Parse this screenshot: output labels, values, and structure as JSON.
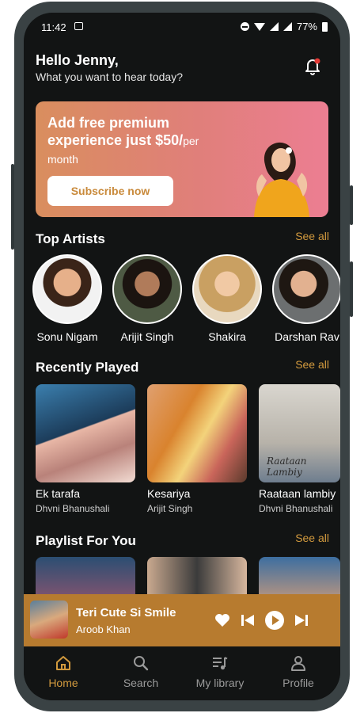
{
  "status": {
    "time": "11:42",
    "battery": "77%"
  },
  "greeting": {
    "title": "Hello Jenny,",
    "subtitle": "What you want to hear today?"
  },
  "banner": {
    "line1": "Add free premium",
    "line2": "experience just $50/",
    "per": "per",
    "line3": "month",
    "button": "Subscribe now"
  },
  "top_artists": {
    "title": "Top Artists",
    "see_all": "See all",
    "items": [
      {
        "name": "Sonu Nigam"
      },
      {
        "name": "Arijit Singh"
      },
      {
        "name": "Shakira"
      },
      {
        "name": "Darshan Rav"
      }
    ]
  },
  "recently_played": {
    "title": "Recently Played",
    "see_all": "See all",
    "items": [
      {
        "title": "Ek tarafa",
        "artist": "Dhvni Bhanushali"
      },
      {
        "title": "Kesariya",
        "artist": "Arijit Singh"
      },
      {
        "title": "Raataan lambiy",
        "artist": "Dhvni Bhanushali",
        "art_text": "Raataan Lambiy"
      }
    ]
  },
  "playlist": {
    "title": "Playlist For You",
    "see_all": "See all"
  },
  "now_playing": {
    "title": "Teri Cute Si Smile",
    "artist": "Aroob Khan"
  },
  "nav": {
    "home": "Home",
    "search": "Search",
    "library": "My library",
    "profile": "Profile"
  },
  "colors": {
    "accent": "#d29a3e",
    "player_bg": "#b77b2f",
    "background": "#121414"
  }
}
